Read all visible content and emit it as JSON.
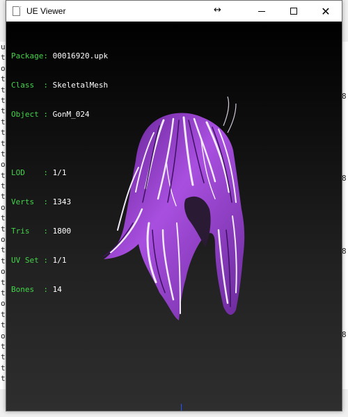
{
  "window": {
    "title": "UE Viewer"
  },
  "info": {
    "package": {
      "label": "Package",
      "value": "00016920.upk"
    },
    "class": {
      "label": "Class  ",
      "value": "SkeletalMesh"
    },
    "object": {
      "label": "Object ",
      "value": "GonM_024"
    },
    "lod": {
      "label": "LOD    ",
      "value": "1/1"
    },
    "verts": {
      "label": "Verts  ",
      "value": "1343"
    },
    "tris": {
      "label": "Tris   ",
      "value": "1800"
    },
    "uvset": {
      "label": "UV Set ",
      "value": "1/1"
    },
    "bones": {
      "label": "Bones  ",
      "value": "14"
    }
  },
  "colors": {
    "label": "#44d44a",
    "value": "#ffffff",
    "hair_dark": "#8a2fc2",
    "hair_light": "#f3eefa"
  },
  "icons": [
    "app-icon",
    "resize-cursor-icon",
    "minimize-icon",
    "maximize-icon",
    "close-icon"
  ]
}
